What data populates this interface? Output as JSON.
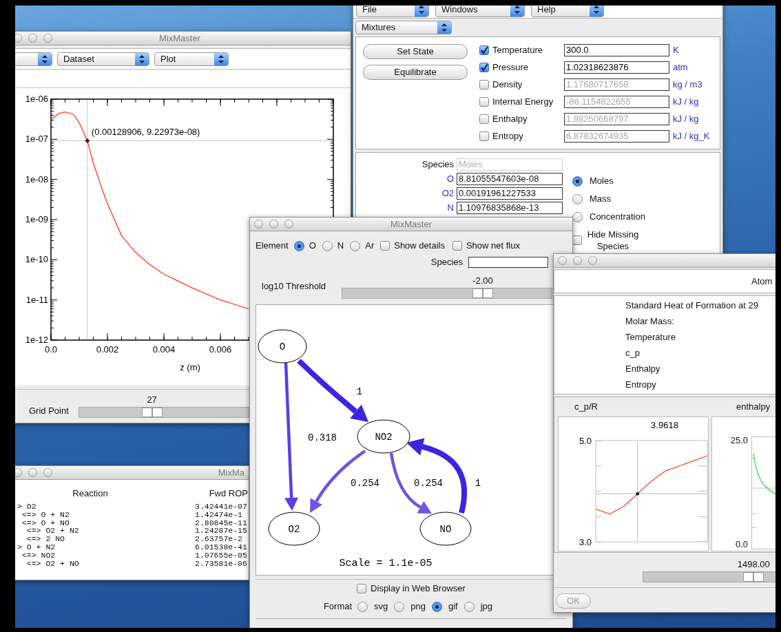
{
  "plot_window": {
    "title": "MixMaster",
    "dropdowns": [
      "Dataset",
      "Plot"
    ],
    "chart": {
      "kind": "picture",
      "xlabel": "z (m)",
      "xtick_labels": [
        "0.0",
        "0.002",
        "0.004",
        "0.006"
      ],
      "ytick_labels": [
        "1e-06",
        "1e-07",
        "1e-08",
        "1e-09",
        "1e-10",
        "1e-11",
        "1e-12"
      ],
      "annotation": "(0.00128906, 9.22973e-08)"
    },
    "grid_point": {
      "label": "Grid Point",
      "reading": "27",
      "level": 0.43
    }
  },
  "mixture_window": {
    "menus": [
      "File",
      "Windows",
      "Help"
    ],
    "mode": "Mixtures",
    "buttons": [
      "Set State",
      "Equilibrate"
    ],
    "properties": [
      {
        "label": "Temperature",
        "checked": true,
        "value": "300.0",
        "unit": "K"
      },
      {
        "label": "Pressure",
        "checked": true,
        "value": "1.02318623876",
        "unit": "atm"
      },
      {
        "label": "Density",
        "checked": false,
        "value": "1.17680717658",
        "unit": "kg / m3"
      },
      {
        "label": "Internal Energy",
        "checked": false,
        "value": "-86.1154822655",
        "unit": "kJ / kg"
      },
      {
        "label": "Enthalpy",
        "checked": false,
        "value": "1.98250668797",
        "unit": "kJ / kg"
      },
      {
        "label": "Entropy",
        "checked": false,
        "value": "6.87832674935",
        "unit": "kJ / kg_K"
      }
    ],
    "species_header": {
      "label": "Species",
      "value": "Moles",
      "disabled": true
    },
    "species": [
      {
        "label": "O",
        "value": "8.81055547603e-08"
      },
      {
        "label": "O2",
        "value": "0.00191961227533"
      },
      {
        "label": "N",
        "value": "1.10976835868e-13"
      }
    ],
    "basis": [
      {
        "label": "Moles",
        "selected": true
      },
      {
        "label": "Mass",
        "selected": false
      },
      {
        "label": "Concentration",
        "selected": false
      }
    ],
    "hide_missing": {
      "label": "Hide Missing Species",
      "checked": false
    }
  },
  "reactions_window": {
    "title": "MixMa",
    "columns": [
      "Reaction",
      "Fwd ROP"
    ],
    "rows": [
      {
        "reaction": "> O2",
        "rop": "3.42441e-07"
      },
      {
        "reaction": " <=> O + N2",
        "rop": "1.42474e-1"
      },
      {
        "reaction": " <=> O + NO",
        "rop": "2.80845e-11"
      },
      {
        "reaction": "  <=> O2 + N2",
        "rop": "1.24287e-15"
      },
      {
        "reaction": "  <=> 2 NO",
        "rop": "2.63757e-2"
      },
      {
        "reaction": "> O + N2",
        "rop": "6.01538e-41"
      },
      {
        "reaction": " <=> NO2",
        "rop": "1.07655e-05"
      },
      {
        "reaction": "  <=> O2 + NO",
        "rop": "2.73581e-06"
      }
    ]
  },
  "path_window": {
    "title": "MixMaster",
    "element_label": "Element",
    "elements": [
      {
        "label": "O",
        "selected": true
      },
      {
        "label": "N",
        "selected": false
      },
      {
        "label": "Ar",
        "selected": false
      }
    ],
    "options": [
      {
        "label": "Show details",
        "checked": false
      },
      {
        "label": "Show net flux",
        "checked": false
      }
    ],
    "species_label": "Species",
    "threshold": {
      "label": "log10 Threshold",
      "reading": "-2.00",
      "level": 0.67
    },
    "graph": {
      "nodes": [
        "O",
        "NO2",
        "O2",
        "NO"
      ],
      "edges": [
        {
          "label": "1",
          "kind": "major",
          "color": "#3b24e2"
        },
        {
          "label": "0.318",
          "kind": "minor",
          "color": "#5a3fe6"
        },
        {
          "label": "0.254",
          "kind": "minor",
          "color": "#6b55e3"
        },
        {
          "label": "0.254",
          "kind": "minor",
          "color": "#6b55e3"
        },
        {
          "label": "1",
          "kind": "major",
          "color": "#3b24e2"
        }
      ],
      "scale": "Scale = 1.1e-05"
    },
    "web_browser": {
      "label": "Display in Web Browser",
      "checked": false
    },
    "format_label": "Format",
    "formats": [
      {
        "label": "svg",
        "selected": false
      },
      {
        "label": "png",
        "selected": false
      },
      {
        "label": "gif",
        "selected": true
      },
      {
        "label": "jpg",
        "selected": false
      }
    ]
  },
  "species_window": {
    "header": "Atom",
    "properties": [
      "Standard Heat of Formation at 29",
      "Molar Mass:",
      "Temperature",
      "c_p",
      "Enthalpy",
      "Entropy"
    ],
    "charts": [
      {
        "chart_data": {
          "type": "line",
          "title": "c_p/R",
          "categories": [
            null,
            null,
            null,
            null,
            null,
            null,
            null,
            null,
            null
          ],
          "series": [
            {
              "color": "#ff3b1f",
              "values": [
                3.65,
                3.55,
                3.7,
                3.95,
                4.2,
                4.4,
                4.5,
                4.6,
                4.7
              ]
            }
          ],
          "ylim": [
            3,
            5
          ],
          "yticks": [
            {
              "value": 3,
              "label": "3.0"
            },
            {
              "value": 5,
              "label": "5.0"
            }
          ],
          "annotations": [
            {
              "text": "3.9618"
            }
          ]
        }
      },
      {
        "kind": "picture",
        "title": "enthalpy",
        "tick_labels": [
          "25.0",
          "0.0"
        ]
      }
    ],
    "temperature": {
      "reading": "1498.00",
      "level": 0.58
    },
    "ok_button": {
      "label": "OK",
      "disabled": true
    }
  }
}
